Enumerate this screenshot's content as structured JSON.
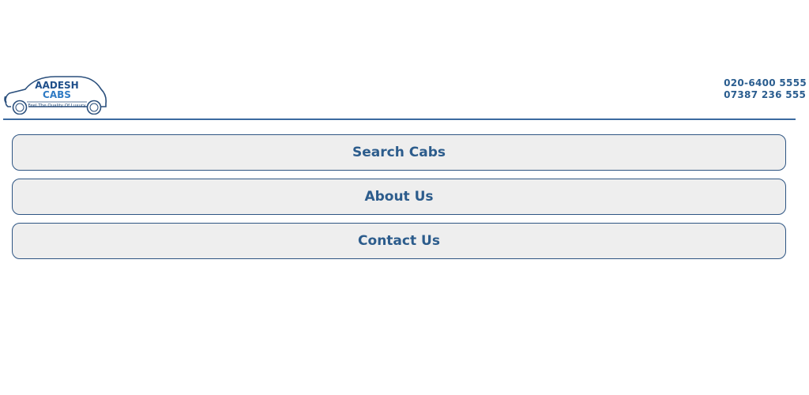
{
  "header": {
    "logo": {
      "name": "AADESH",
      "sub": "CABS",
      "tagline": "Feel The Quality Of Luxury"
    },
    "phones": [
      "020-6400 5555",
      "07387 236 555"
    ]
  },
  "nav": {
    "items": [
      {
        "label": "Search Cabs"
      },
      {
        "label": "About Us"
      },
      {
        "label": "Contact Us"
      }
    ]
  },
  "colors": {
    "brand_blue": "#2c5c8c",
    "button_bg": "#eeeeee",
    "divider": "#3b6aa0"
  }
}
